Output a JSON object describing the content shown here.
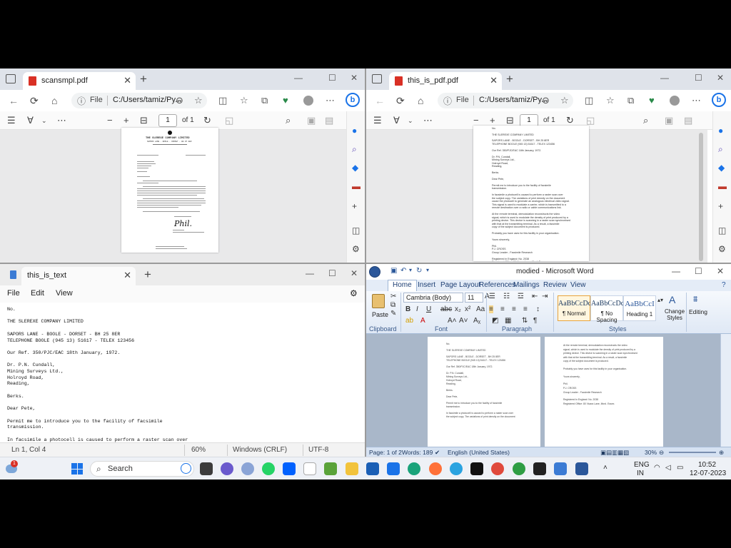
{
  "edge1": {
    "tab_title": "scansmpl.pdf",
    "url_label": "File",
    "url_path": "C:/Users/tamiz/Py...",
    "page_input": "1",
    "page_of": "of 1",
    "doc": {
      "company": "THE SLEREXE COMPANY LIMITED",
      "address": "SAPORS LANE - BOOLE - DORSET - BH 25 8ER"
    }
  },
  "edge2": {
    "tab_title": "this_is_pdf.pdf",
    "url_label": "File",
    "url_path": "C:/Users/tamiz/Py...",
    "page_input": "1",
    "page_of": "of 1",
    "doc_lines": [
      "No.",
      "THE SLEREXE COMPANY LIMITED",
      "SAPORS LANE - BOOLE - DORSET - BH 25 8ER",
      "TELEPHONE BOOLE (945 13) 51617 - TELEX 123456",
      "Our Ref. 350/PJC/EAC 18th January, 1972.",
      "Dr. P.N. Cundall,",
      "Mining Surveys Ltd.,",
      "Holroyd Road,",
      "Reading,",
      "Berks.",
      "Dear Pete,",
      "Permit me to introduce you to the facility of facsimile",
      "transmission.",
      "In facsimile a photocell is caused to perform a raster scan over",
      "the subject copy. The variations of print density on the document",
      "cause the photocell to generate an analogous electrical video signal.",
      "This signal is used to modulate a carrier, which is transmitted to a",
      "remote destination over a radio or cable communications link.",
      "At the remote terminal, demodulation reconstructs the video",
      "signal, which is used to modulate the density of print produced by a",
      "printing device. This device is scanning in a raster scan synchronised",
      "with that at the transmitting terminal. As a result, a facsimile",
      "copy of the subject document is produced.",
      "Probably you have uses for this facility in your organisation.",
      "Yours sincerely,",
      "Phil.",
      "P.J. CROSS",
      "Group Leader - Facsimile Research",
      "Registered in England: No. 2038",
      "Registered Office: 80 Vicara Lane, Ilford. Essex."
    ]
  },
  "notepad": {
    "tab_title": "this_is_text",
    "menu": [
      "File",
      "Edit",
      "View"
    ],
    "text": "No.\n\nTHE SLEREXE COMPANY LIMITED\n\nSAPORS LANE - BOOLE - DORSET - BH 25 8ER\nTELEPHONE BOOLE (945 13) 51617 - TELEX 123456\n\nOur Ref. 350/PJC/EAC 18th January, 1972.\n\nDr. P.N. Cundall,\nMining Surveys Ltd.,\nHolroyd Road,\nReading,\n\nBerks.\n\nDear Pete,\n\nPermit me to introduce you to the facility of facsimile\ntransmission.\n\nIn facsimile a photocell is caused to perform a raster scan over\nthe subject copy. The variations of print density on the document\ncause the photocell to generate an analogous electrical video signal.\nThis signal is used to modulate a carrier, which is transmitted to a\nremote destination over a radio or cable communications link.\n\nAt the remote terminal, demodulation reconstructs the video\nsignal, which is used to modulate the density of print produced by a\nprinting device. This device is scanning in a raster scan synchronised",
    "status": {
      "position": "Ln 1, Col 4",
      "zoom": "60%",
      "line_ending": "Windows (CRLF)",
      "encoding": "UTF-8"
    }
  },
  "word": {
    "title": "modied - Microsoft Word",
    "tabs": [
      "Home",
      "Insert",
      "Page Layout",
      "References",
      "Mailings",
      "Review",
      "View"
    ],
    "clipboard": {
      "paste": "Paste",
      "label": "Clipboard"
    },
    "font": {
      "name": "Cambria (Body)",
      "size": "11",
      "label": "Font"
    },
    "paragraph_label": "Paragraph",
    "styles": [
      {
        "sample": "AaBbCcDc",
        "name": "¶ Normal"
      },
      {
        "sample": "AaBbCcDc",
        "name": "¶ No Spacing"
      },
      {
        "sample": "AaBbCcI",
        "name": "Heading 1"
      }
    ],
    "styles_label": "Styles",
    "change_styles": "Change Styles",
    "editing": "Editing",
    "left_page_lines": [
      "No.",
      "THE SLEREXE COMPANY LIMITED",
      "SAPORS LANE - BOOLE - DORSET - BH 25 8ER",
      "TELEPHONE BOOLE (945 13) 51617 - TELEX 123456",
      "Our Ref. 350/PJC/EAC 18th January, 1972.",
      "Dr. P.N. Cundall,",
      "Mining Surveys Ltd.,",
      "Holroyd Road,",
      "Reading,",
      "Berks.",
      "Dear Pete,",
      "Permit me to introduce you to the facility of facsimile",
      "transmission.",
      "In facsimile a photocell is caused to perform a raster scan over",
      "the subject copy. The variations of print density on the document"
    ],
    "right_page_lines": [
      "At the remote terminal, demodulation reconstructs the video",
      "signal, which is used to modulate the density of print produced by a",
      "printing device. This device is scanning in a raster scan synchronised",
      "with that at the transmitting terminal. As a result, a facsimile",
      "copy of the subject document is produced.",
      "Probably you have uses for this facility in your organisation.",
      "Yours sincerely,",
      "Phil.",
      "P.J. CROSS",
      "Group Leader - Facsimile Research",
      "Registered in England: No. 2038",
      "Registered Office: 80 Vicara Lane, Ilford. Essex."
    ],
    "status": {
      "page": "Page: 1 of 2",
      "words": "Words: 189",
      "language": "English (United States)",
      "zoom": "30%"
    }
  },
  "taskbar": {
    "search": "Search",
    "lang_top": "ENG",
    "lang_bottom": "IN",
    "time": "10:52",
    "date": "12-07-2023",
    "badge": "1"
  },
  "colors": {
    "edge_tab_bg": "#dfe3ea",
    "word_blue": "#2b579a",
    "pdf_red": "#d93025",
    "taskbar": "#eef1f6"
  }
}
